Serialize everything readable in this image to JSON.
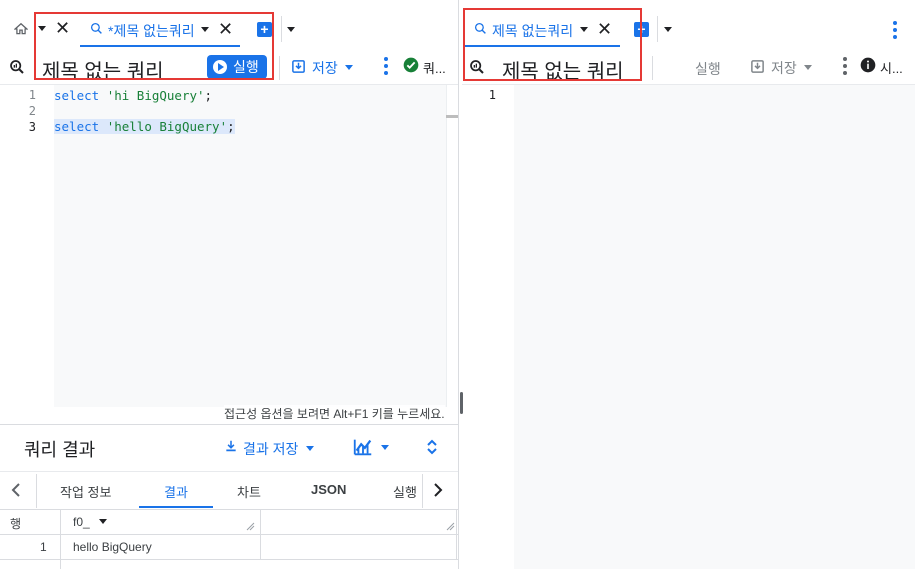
{
  "left": {
    "tabs": {
      "query_tab_label": "*제목 없는쿼리"
    },
    "toolbar": {
      "title": "제목 없는 쿼리",
      "run_label": "실행",
      "save_label": "저장",
      "status_label": "쿼..."
    },
    "editor": {
      "line_numbers": [
        "1",
        "2",
        "3"
      ],
      "lines": [
        {
          "keyword": "select",
          "string": "'hi BigQuery'",
          "end": ";"
        },
        {
          "keyword": "",
          "string": "",
          "end": ""
        },
        {
          "keyword": "select",
          "string": "'hello BigQuery'",
          "end": ";"
        }
      ],
      "accessibility_hint": "접근성 옵션을 보려면 Alt+F1 키를 누르세요."
    },
    "results": {
      "title": "쿼리 결과",
      "save_results_label": "결과 저장",
      "subtabs": [
        "작업 정보",
        "결과",
        "차트",
        "JSON",
        "실행"
      ],
      "active_subtab": "결과",
      "columns": [
        "행",
        "f0_"
      ],
      "rows": [
        {
          "row": "1",
          "f0_": "hello BigQuery"
        }
      ]
    }
  },
  "right": {
    "tabs": {
      "query_tab_label": "제목 없는쿼리"
    },
    "toolbar": {
      "title": "제목 없는 쿼리",
      "run_label": "실행",
      "save_label": "저장",
      "info_label": "시..."
    },
    "editor": {
      "line_numbers": [
        "1"
      ]
    }
  },
  "colors": {
    "accent": "#1a73e8",
    "highlight_box": "#e53935",
    "success": "#188038"
  },
  "icons": [
    "home-icon",
    "close-icon",
    "query-icon",
    "add-tab-icon",
    "chevron-down-icon",
    "query-explorer-icon",
    "play-icon",
    "save-icon",
    "more-vert-icon",
    "check-circle-icon",
    "info-icon",
    "download-icon",
    "chart-icon",
    "expand-icon",
    "chevron-left-icon",
    "chevron-right-icon"
  ]
}
